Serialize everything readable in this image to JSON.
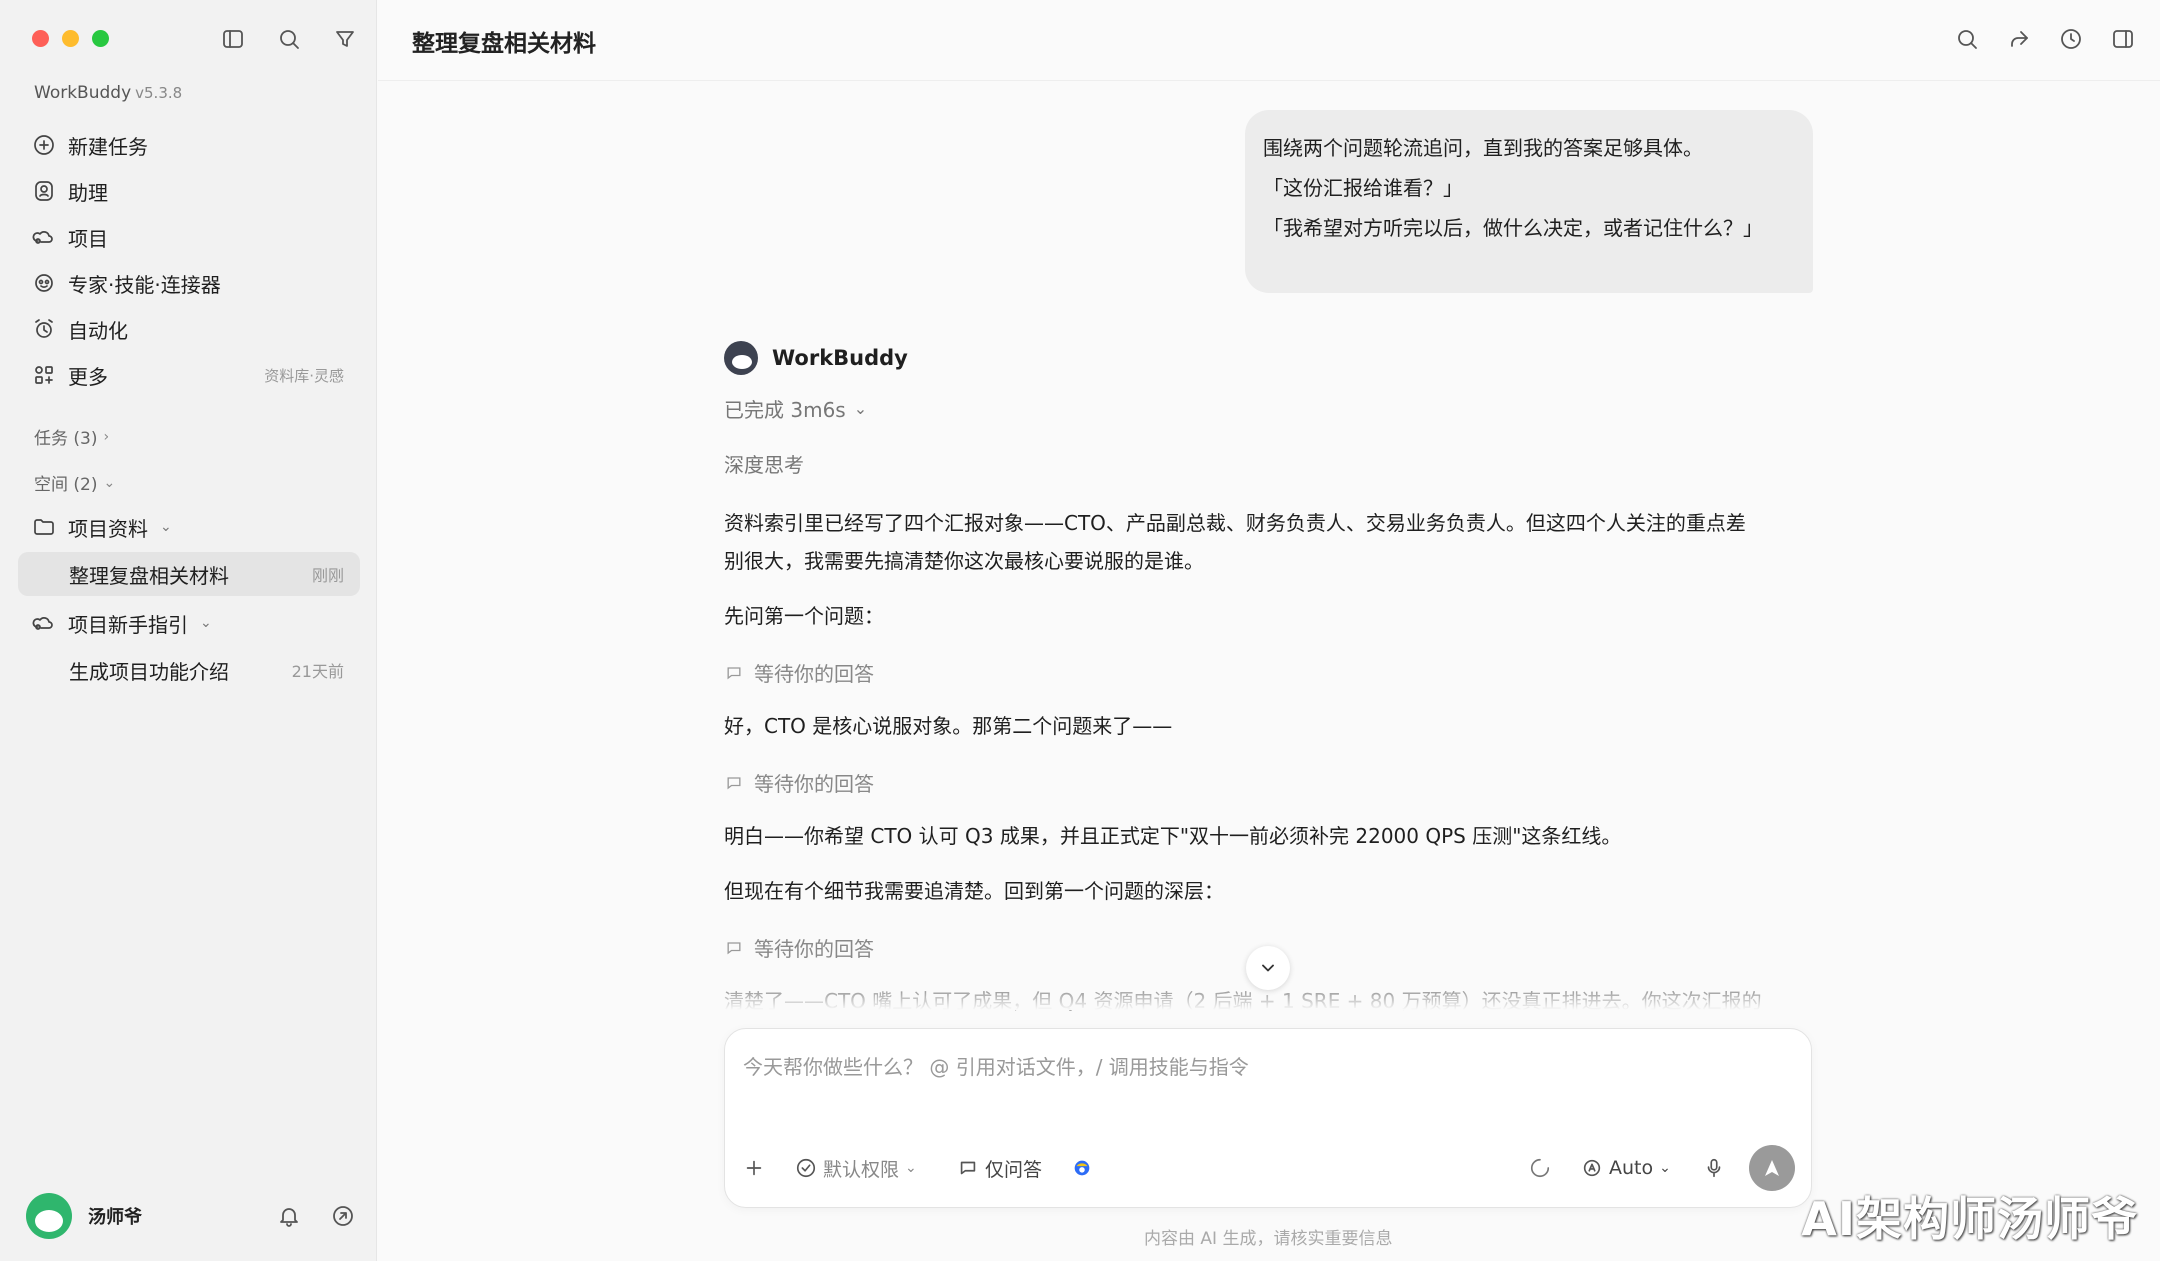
{
  "sidebar": {
    "app_name": "WorkBuddy",
    "version": "v5.3.8",
    "nav": [
      {
        "label": "新建任务",
        "icon": "plus-circle-icon"
      },
      {
        "label": "助理",
        "icon": "assistant-icon"
      },
      {
        "label": "项目",
        "icon": "project-icon"
      },
      {
        "label": "专家·技能·连接器",
        "icon": "experts-icon"
      },
      {
        "label": "自动化",
        "icon": "alarm-icon"
      },
      {
        "label": "更多",
        "icon": "grid-icon",
        "note": "资料库·灵感"
      }
    ],
    "sections": {
      "tasks": "任务 (3)",
      "spaces": "空间 (2)"
    },
    "tree": [
      {
        "label": "项目资料",
        "icon": "folder-icon"
      },
      {
        "label": "整理复盘相关材料",
        "note": "刚刚"
      },
      {
        "label": "项目新手指引",
        "icon": "project-icon"
      },
      {
        "label": "生成项目功能介绍",
        "note": "21天前"
      }
    ],
    "user": {
      "name": "汤师爷"
    }
  },
  "header": {
    "title": "整理复盘相关材料"
  },
  "user_message": {
    "lines": [
      "围绕两个问题轮流追问，直到我的答案足够具体。",
      "「这份汇报给谁看？」",
      "「我希望对方听完以后，做什么决定，或者记住什么？」"
    ]
  },
  "assistant": {
    "name": "WorkBuddy",
    "status": "已完成 3m6s",
    "thinking": "深度思考",
    "paragraph1_line1": "资料索引里已经写了四个汇报对象——CTO、产品副总裁、财务负责人、交易业务负责人。但这四个人关注的重点差",
    "paragraph1_line2": "别很大，我需要先搞清楚你这次最核心要说服的是谁。",
    "q1": "先问第一个问题：",
    "wait": "等待你的回答",
    "reply2": "好，CTO 是核心说服对象。那第二个问题来了——",
    "reply3": "明白——你希望 CTO 认可 Q3 成果，并且正式定下\"双十一前必须补完 22000 QPS 压测\"这条红线。",
    "reply4": "但现在有个细节我需要追清楚。回到第一个问题的深层：",
    "reply5": "清楚了——CTO 嘴上认可了成果，但 Q4 资源申请（2 后端 + 1 SRE + 80 万预算）还没真正排进去。你这次汇报的"
  },
  "composer": {
    "placeholder": "今天帮你做些什么？ @ 引用对话文件，/ 调用技能与指令",
    "permission": "默认权限",
    "ask_only": "仅问答",
    "model": "Auto"
  },
  "footer_note": "内容由 AI 生成，请核实重要信息",
  "watermark": "AI架构师汤师爷"
}
